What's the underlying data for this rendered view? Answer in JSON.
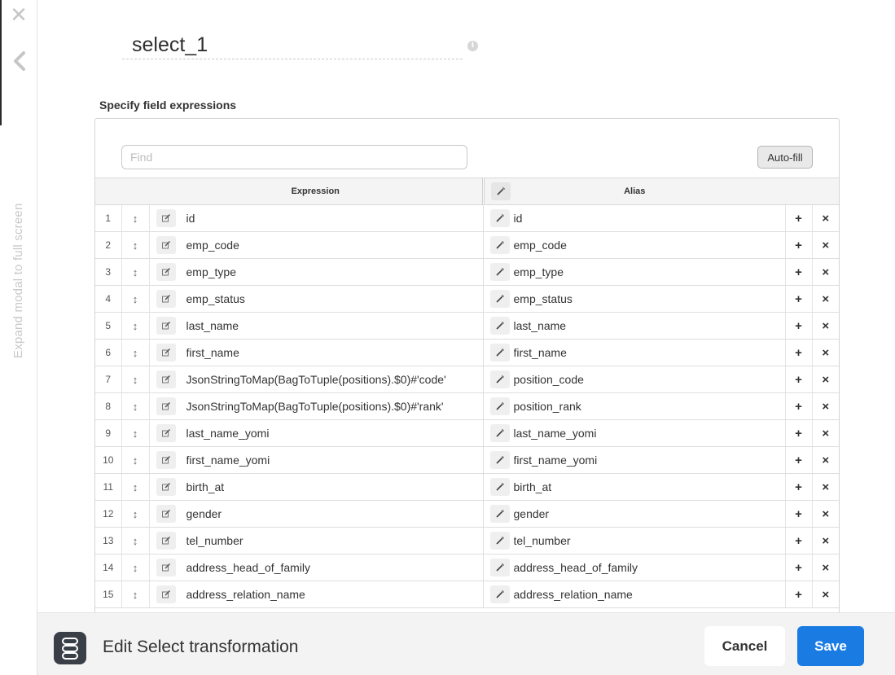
{
  "rail": {
    "close_icon": "close-icon",
    "back_icon": "chevron-left-icon",
    "expand_label": "Expand modal to full screen"
  },
  "header": {
    "title": "select_1",
    "info_icon": "info-icon"
  },
  "section": {
    "label": "Specify field expressions"
  },
  "toolbar": {
    "find_placeholder": "Find",
    "autofill_label": "Auto-fill"
  },
  "table": {
    "headers": {
      "expression": "Expression",
      "alias": "Alias"
    },
    "rows": [
      {
        "num": "1",
        "expression": "id",
        "alias": "id"
      },
      {
        "num": "2",
        "expression": "emp_code",
        "alias": "emp_code"
      },
      {
        "num": "3",
        "expression": "emp_type",
        "alias": "emp_type"
      },
      {
        "num": "4",
        "expression": "emp_status",
        "alias": "emp_status"
      },
      {
        "num": "5",
        "expression": "last_name",
        "alias": "last_name"
      },
      {
        "num": "6",
        "expression": "first_name",
        "alias": "first_name"
      },
      {
        "num": "7",
        "expression": "JsonStringToMap(BagToTuple(positions).$0)#'code'",
        "alias": "position_code"
      },
      {
        "num": "8",
        "expression": "JsonStringToMap(BagToTuple(positions).$0)#'rank'",
        "alias": "position_rank"
      },
      {
        "num": "9",
        "expression": "last_name_yomi",
        "alias": "last_name_yomi"
      },
      {
        "num": "10",
        "expression": "first_name_yomi",
        "alias": "first_name_yomi"
      },
      {
        "num": "11",
        "expression": "birth_at",
        "alias": "birth_at"
      },
      {
        "num": "12",
        "expression": "gender",
        "alias": "gender"
      },
      {
        "num": "13",
        "expression": "tel_number",
        "alias": "tel_number"
      },
      {
        "num": "14",
        "expression": "address_head_of_family",
        "alias": "address_head_of_family"
      },
      {
        "num": "15",
        "expression": "address_relation_name",
        "alias": "address_relation_name"
      }
    ],
    "row_icons": {
      "drag": "drag-handle-icon",
      "edit": "edit-icon",
      "wand": "magic-wand-icon",
      "add": "+",
      "remove": "×"
    }
  },
  "footer": {
    "icon": "transformation-icon",
    "title": "Edit Select transformation",
    "cancel_label": "Cancel",
    "save_label": "Save"
  },
  "colors": {
    "primary": "#1a7ce3",
    "footer_bg": "#f3f3f3"
  }
}
